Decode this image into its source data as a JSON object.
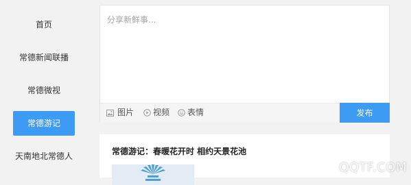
{
  "sidebar": {
    "items": [
      {
        "label": "首页"
      },
      {
        "label": "常德新闻联播"
      },
      {
        "label": "常德微视"
      },
      {
        "label": "常德游记",
        "active": true
      },
      {
        "label": "天南地北常德人"
      }
    ]
  },
  "composer": {
    "placeholder": "分享新鲜事...",
    "tools": {
      "image": "图片",
      "video": "视频",
      "emoji": "表情"
    },
    "publish_label": "发布"
  },
  "feed": {
    "posts": [
      {
        "title": "常德游记：春暖花开时 相约天景花池"
      }
    ]
  },
  "watermark": "QQTF.COM",
  "colors": {
    "accent": "#3d9bf3",
    "background": "#f2f2f2"
  }
}
